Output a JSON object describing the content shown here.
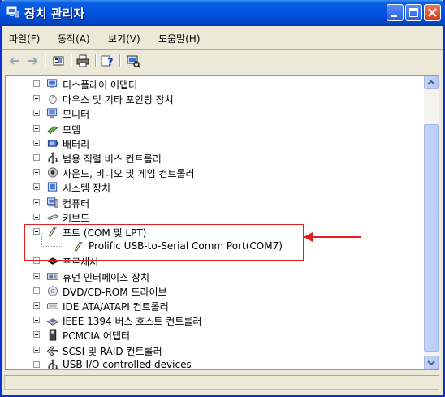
{
  "window": {
    "title": "장치 관리자"
  },
  "menu": [
    {
      "label": "파일(F)"
    },
    {
      "label": "동작(A)"
    },
    {
      "label": "보기(V)"
    },
    {
      "label": "도움말(H)"
    }
  ],
  "toolbar": {
    "buttons": [
      "back-icon",
      "forward-icon",
      "properties-icon",
      "print-icon",
      "help-icon",
      "scan-hardware-icon"
    ]
  },
  "tree": {
    "items": [
      {
        "label": "디스플레이 어댑터",
        "icon": "display-adapter-icon"
      },
      {
        "label": "마우스 및 기타 포인팅 장치",
        "icon": "mouse-icon"
      },
      {
        "label": "모니터",
        "icon": "monitor-icon"
      },
      {
        "label": "모뎀",
        "icon": "modem-icon"
      },
      {
        "label": "배터리",
        "icon": "battery-icon"
      },
      {
        "label": "범용 직렬 버스 컨트롤러",
        "icon": "usb-icon"
      },
      {
        "label": "사운드, 비디오 및 게임 컨트롤러",
        "icon": "sound-icon"
      },
      {
        "label": "시스템 장치",
        "icon": "system-icon"
      },
      {
        "label": "컴퓨터",
        "icon": "computer-icon"
      },
      {
        "label": "키보드",
        "icon": "keyboard-icon"
      },
      {
        "label": "포트 (COM 및 LPT)",
        "icon": "port-icon"
      },
      {
        "label": "Prolific USB-to-Serial Comm Port(COM7)",
        "icon": "port-icon"
      },
      {
        "label": "프로세서",
        "icon": "processor-icon"
      },
      {
        "label": "휴먼 인터페이스 장치",
        "icon": "hid-icon"
      },
      {
        "label": "DVD/CD-ROM 드라이브",
        "icon": "cdrom-icon"
      },
      {
        "label": "IDE ATA/ATAPI 컨트롤러",
        "icon": "ide-icon"
      },
      {
        "label": "IEEE 1394 버스 호스트 컨트롤러",
        "icon": "ieee1394-icon"
      },
      {
        "label": "PCMCIA 어댑터",
        "icon": "pcmcia-icon"
      },
      {
        "label": "SCSI 및 RAID 컨트롤러",
        "icon": "scsi-icon"
      },
      {
        "label": "USB I/O controlled devices",
        "icon": "usb-icon"
      }
    ]
  },
  "annotation": {
    "arrow_color": "#e02020",
    "box_color": "#e02020"
  },
  "colors": {
    "titlebar": "#0054e3",
    "window_bg": "#ece9d8"
  }
}
